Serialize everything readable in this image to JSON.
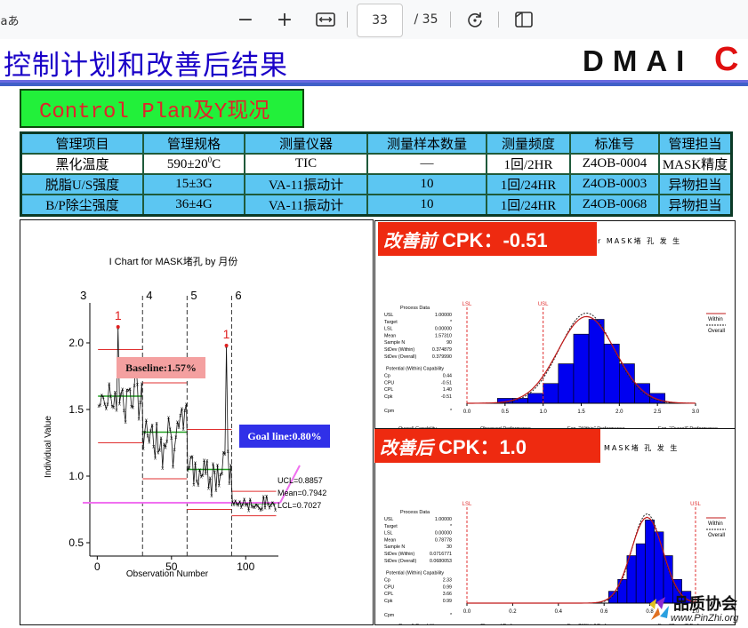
{
  "toolbar": {
    "lang_label": "aあ",
    "zoom_out": "−",
    "zoom_in": "+",
    "page_current": "33",
    "page_total": "/ 35"
  },
  "slide": {
    "title": "控制计划和改善后结果",
    "dmaic_letters": "DMAI",
    "dmaic_last": "C",
    "control_plan_label": "Control Plan及Y现况"
  },
  "table": {
    "headers": [
      "管理项目",
      "管理规格",
      "测量仪器",
      "测量样本数量",
      "测量频度",
      "标准号",
      "管理担当"
    ],
    "rows": [
      [
        "黑化温度",
        "590±20",
        "TIC",
        "—",
        "1回/2HR",
        "Z4OB-0004",
        "MASK精度"
      ],
      [
        "脱脂U/S强度",
        "15±3G",
        "VA-11振动计",
        "10",
        "1回/24HR",
        "Z4OB-0003",
        "异物担当"
      ],
      [
        "B/P除尘强度",
        "36±4G",
        "VA-11振动计",
        "10",
        "1回/24HR",
        "Z4OB-0068",
        "异物担当"
      ]
    ],
    "spec_superscript": "0",
    "spec_unit": "C"
  },
  "ichart": {
    "title": "I Chart for MASK堵孔 by 月份",
    "ylabel": "Individual Value",
    "xlabel": "Observation Number",
    "stage_labels": [
      "3",
      "4",
      "5",
      "6"
    ],
    "baseline_label": "Baseline:1.57%",
    "goal_label": "Goal line:0.80%",
    "ucl": "UCL=0.8857",
    "mean": "Mean=0.7942",
    "lcl": "LCL=0.7027",
    "flag": "1",
    "y_ticks": [
      "2.0",
      "1.5",
      "1.0",
      "0.5"
    ],
    "x_ticks": [
      "0",
      "50",
      "100"
    ]
  },
  "before": {
    "label_cn": "改善前",
    "label_value": "CPK：-0.51",
    "mask_text": "r MASK堵 孔 发 生",
    "lsl": "LSL",
    "usl": "USL",
    "legend": [
      "Within",
      "Overall"
    ],
    "process_title": "Process Data",
    "process_rows": [
      [
        "USL",
        "1.00000"
      ],
      [
        "Target",
        "*"
      ],
      [
        "LSL",
        "0.00000"
      ],
      [
        "Mean",
        "1.57310"
      ],
      [
        "Sample N",
        "90"
      ],
      [
        "StDev (Within)",
        "0.374879"
      ],
      [
        "StDev (Overall)",
        "0.379990"
      ]
    ],
    "potential_title": "Potential (Within) Capability",
    "potential_rows": [
      [
        "Cp",
        "0.44"
      ],
      [
        "CPU",
        "-0.51"
      ],
      [
        "CPL",
        "1.40"
      ],
      [
        "Cpk",
        "-0.51"
      ],
      [
        "Cpm",
        "*"
      ]
    ],
    "overall_title": "Overall Capability",
    "overall_rows": [
      [
        "Pp",
        "0.44"
      ],
      [
        "PPU",
        "-0.50"
      ],
      [
        "PPL",
        "1.38"
      ],
      [
        "Ppk",
        "-0.50"
      ]
    ],
    "observed_title": "Observed Performance",
    "observed_rows": [
      [
        "PPM < LSL",
        "0.00"
      ],
      [
        "PPM > USL",
        "933333.33"
      ],
      [
        "PPM Total",
        "933333.33"
      ]
    ],
    "within_title": "Exp. \"Within\" Performance",
    "within_rows": [
      [
        "PPM < LSL",
        "13.17"
      ],
      [
        "PPM > USL",
        "936839.73"
      ],
      [
        "PPM Total",
        "936853.29"
      ]
    ],
    "overall_perf_title": "Exp. \"Overall\" Performance",
    "overall_perf_rows": [
      [
        "PPM < LSL",
        "11.38"
      ],
      [
        "PPM > USL",
        "934249.86"
      ],
      [
        "PPM Total",
        "934267.23"
      ]
    ],
    "x_ticks": [
      "0.0",
      "0.5",
      "1.0",
      "1.5",
      "2.0",
      "2.5",
      "3.0"
    ]
  },
  "after": {
    "label_cn": "改善后",
    "label_value": "CPK：1.0",
    "mask_text": "MASK堵 孔 发 生",
    "lsl": "LSL",
    "usl": "USL",
    "legend": [
      "Within",
      "Overall"
    ],
    "process_title": "Process Data",
    "process_rows": [
      [
        "USL",
        "1.00000"
      ],
      [
        "Target",
        "*"
      ],
      [
        "LSL",
        "0.00000"
      ],
      [
        "Mean",
        "0.78778"
      ],
      [
        "Sample N",
        "30"
      ],
      [
        "StDev (Within)",
        "0.0716771"
      ],
      [
        "StDev (Overall)",
        "0.0680053"
      ]
    ],
    "potential_title": "Potential (Within) Capability",
    "potential_rows": [
      [
        "Cp",
        "2.33"
      ],
      [
        "CPU",
        "0.99"
      ],
      [
        "CPL",
        "3.66"
      ],
      [
        "Cpk",
        "0.99"
      ],
      [
        "Cpm",
        "*"
      ]
    ],
    "overall_title": "Overall Capability",
    "overall_rows": [
      [
        "Pp",
        "2.45"
      ],
      [
        "PPU",
        "1.04"
      ],
      [
        "PPL",
        "3.86"
      ],
      [
        "Ppk",
        "1.04"
      ]
    ],
    "observed_title": "Observed Performance",
    "observed_rows": [
      [
        "PPM < LSL",
        "0.00"
      ],
      [
        "PPM > USL",
        "0.00"
      ],
      [
        "PPM Total",
        "0.00"
      ]
    ],
    "within_title": "Exp. \"Within\" Performance",
    "within_rows": [
      [
        "PPM < LSL",
        "0.00"
      ],
      [
        "PPM > USL",
        "1534.51"
      ],
      [
        "PPM Total",
        "1534.51"
      ]
    ],
    "overall_perf_title": "Exp. \"Overall\" Performance",
    "overall_perf_rows": [
      [
        "PPM < LSL",
        "0.00"
      ],
      [
        "PPM > USL",
        "",
        "0.00"
      ],
      [
        "PPM Total",
        ""
      ]
    ],
    "x_ticks": [
      "0.0",
      "0.2",
      "0.4",
      "0.6",
      "0.8",
      "1.0"
    ]
  },
  "watermark": {
    "brand": "品质协会",
    "url": "www.PinZhi.org"
  },
  "colors": {
    "title_blue": "#1a00c8",
    "dmaic_red": "#e01010",
    "green_box": "#22f03a",
    "table_blue": "#5cc6f2",
    "cpk_red": "#ee2a10",
    "bar_blue": "#0000f0"
  },
  "chart_data": [
    {
      "type": "line",
      "title": "I Chart for MASK堵孔 by 月份",
      "xlabel": "Observation Number",
      "ylabel": "Individual Value",
      "xlim": [
        -5,
        122
      ],
      "ylim": [
        0.4,
        2.3
      ],
      "stages": [
        {
          "name": "3",
          "x_start": 1,
          "x_end": 30,
          "mean": 1.6,
          "ucl": 1.95,
          "lcl": 1.25
        },
        {
          "name": "4",
          "x_start": 31,
          "x_end": 60,
          "mean": 1.33,
          "ucl": 1.7,
          "lcl": 0.98
        },
        {
          "name": "5",
          "x_start": 61,
          "x_end": 90,
          "mean": 1.05,
          "ucl": 1.35,
          "lcl": 0.75
        },
        {
          "name": "6",
          "x_start": 91,
          "x_end": 120,
          "mean": 0.7942,
          "ucl": 0.8857,
          "lcl": 0.7027
        }
      ],
      "baseline": 1.57,
      "goal": 0.8,
      "flagged_points": [
        {
          "x": 14,
          "y": 2.12
        },
        {
          "x": 87,
          "y": 1.98
        }
      ]
    },
    {
      "type": "bar",
      "title": "",
      "categories": [
        "0.3",
        "0.5",
        "0.7",
        "0.9",
        "1.1",
        "1.3",
        "1.5",
        "1.7",
        "1.9",
        "2.1",
        "2.3",
        "2.5"
      ],
      "values": [
        0,
        1,
        1,
        2,
        4,
        8,
        14,
        17,
        12,
        8,
        4,
        2
      ],
      "lsl": 0.0,
      "usl": 1.0,
      "xlim": [
        0.0,
        3.0
      ]
    },
    {
      "type": "bar",
      "title": "",
      "categories": [
        "0.64",
        "0.68",
        "0.72",
        "0.76",
        "0.80",
        "0.84",
        "0.88",
        "0.92",
        "0.96"
      ],
      "values": [
        1,
        2,
        4,
        5,
        7,
        6,
        4,
        2,
        1
      ],
      "lsl": 0.0,
      "usl": 1.0,
      "xlim": [
        0.0,
        1.0
      ]
    }
  ]
}
